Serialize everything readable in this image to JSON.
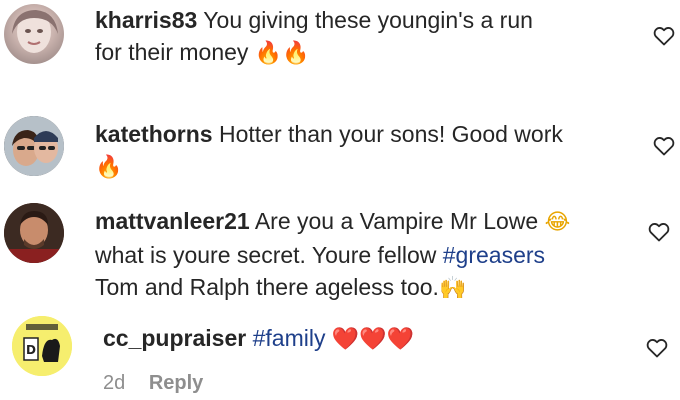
{
  "comments": [
    {
      "username": "kharris83",
      "text_line1": "You giving these youngin's a run",
      "text_line2": "for their money",
      "emoji": "🔥🔥"
    },
    {
      "username": "katethorns",
      "text_line1": "Hotter than your sons! Good work",
      "emoji": "🔥"
    },
    {
      "username": "mattvanleer21",
      "text_line1": "Are you a Vampire Mr Lowe",
      "emoji_line1": "😂",
      "text_line2": "what is youre secret. Youre fellow",
      "hashtag": "#greasers",
      "text_line3": "Tom and Ralph there ageless too.",
      "emoji_line3": "🙌"
    },
    {
      "username": "cc_pupraiser",
      "hashtag": "#family",
      "emoji": "❤️❤️❤️",
      "timestamp": "2d",
      "reply_label": "Reply"
    }
  ],
  "icons": {
    "like": "heart-outline-icon"
  },
  "colors": {
    "text": "#262626",
    "hashtag": "#1e3f8a",
    "meta": "#8e8e8e"
  }
}
